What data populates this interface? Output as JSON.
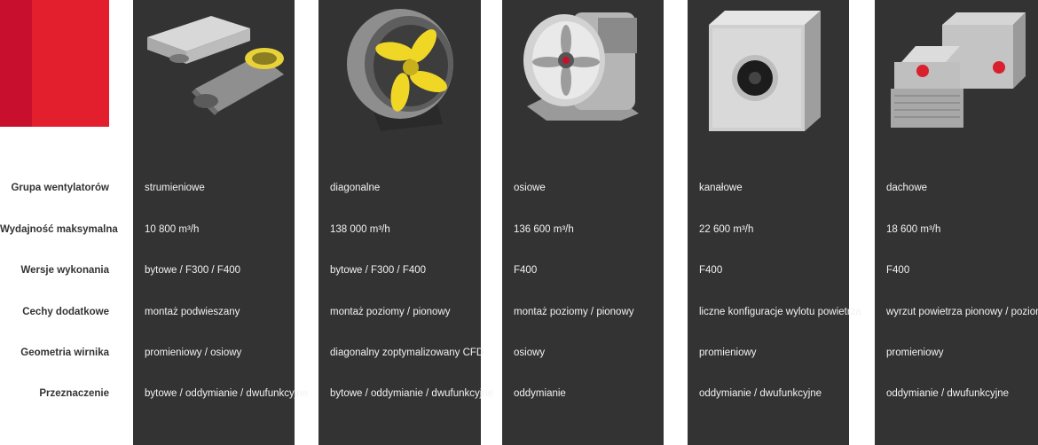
{
  "colors": {
    "brand_red": "#e31e2d",
    "brand_red_dark": "#c8102e",
    "column_bg": "#333333",
    "label_text": "#333333",
    "cell_text": "#f2f2f2"
  },
  "row_labels": [
    "Grupa wentylatorów",
    "Wydajność maksymalna",
    "Wersje wykonania",
    "Cechy dodatkowe",
    "Geometria wirnika",
    "Przeznaczenie"
  ],
  "products": [
    {
      "image": "jet-fan-image",
      "values": [
        "strumieniowe",
        "10 800 m³/h",
        "bytowe / F300 / F400",
        "montaż podwieszany",
        "promieniowy / osiowy",
        "bytowe / oddymianie / dwufunkcyjne"
      ]
    },
    {
      "image": "diagonal-fan-image",
      "values": [
        "diagonalne",
        "138 000 m³/h",
        "bytowe / F300 / F400",
        "montaż poziomy / pionowy",
        "diagonalny zoptymalizowany CFD",
        "bytowe / oddymianie / dwufunkcyjne"
      ]
    },
    {
      "image": "axial-fan-image",
      "values": [
        "osiowe",
        "136 600 m³/h",
        "F400",
        "montaż poziomy / pionowy",
        "osiowy",
        "oddymianie"
      ]
    },
    {
      "image": "duct-fan-image",
      "values": [
        "kanałowe",
        "22 600 m³/h",
        "F400",
        "liczne konfiguracje wylotu powietrza",
        "promieniowy",
        "oddymianie / dwufunkcyjne"
      ]
    },
    {
      "image": "roof-fan-image",
      "values": [
        "dachowe",
        "18 600 m³/h",
        "F400",
        "wyrzut powietrza pionowy / poziomy",
        "promieniowy",
        "oddymianie / dwufunkcyjne"
      ]
    }
  ]
}
